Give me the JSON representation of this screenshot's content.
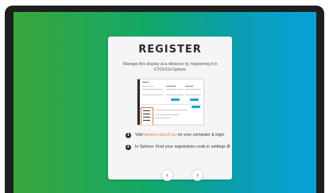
{
  "register": {
    "title": "REGISTER",
    "subtitle": "Manage this display at a distance by registering it in CTOUCH Sphere"
  },
  "steps": [
    {
      "number": "1",
      "prefix": "Visit ",
      "link": "sphere.ctouch.eu",
      "suffix": " on your computer & login"
    },
    {
      "number": "2",
      "text": "In Sphere: Find your registration code in settings",
      "icon": "gear-icon"
    }
  ],
  "navigation": {
    "prev_icon": "chevron-left-icon",
    "prev_glyph": "‹",
    "next_icon": "chevron-right-icon",
    "next_glyph": "›"
  },
  "colors": {
    "accent_link": "#e8782e",
    "gradient_start": "#39a63a",
    "gradient_end": "#07a0d8",
    "highlight": "#e07a3a"
  }
}
